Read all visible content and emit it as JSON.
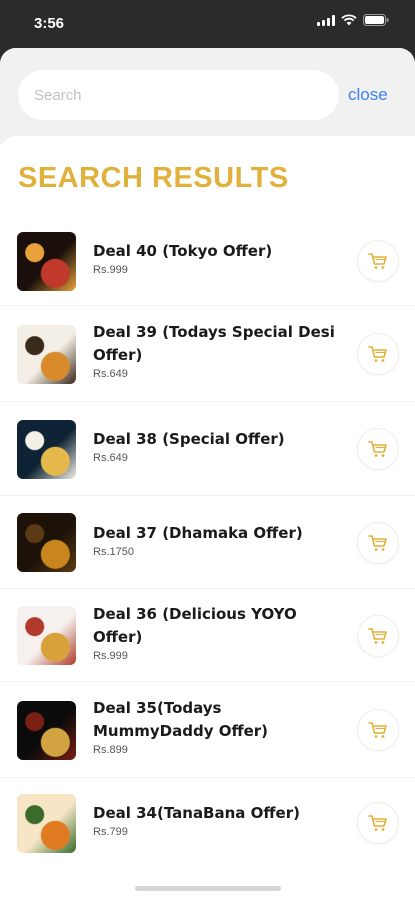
{
  "status_bar": {
    "time": "3:56"
  },
  "search": {
    "placeholder": "Search",
    "value": "",
    "close_label": "close"
  },
  "results": {
    "title": "SEARCH RESULTS",
    "items": [
      {
        "name": "Deal 40 (Tokyo Offer)",
        "price": "Rs.999",
        "thumb_colors": [
          "#1a0f0a",
          "#c0392b",
          "#e9a23b"
        ]
      },
      {
        "name": "Deal 39 (Todays Special Desi Offer)",
        "price": "Rs.649",
        "thumb_colors": [
          "#f3efe6",
          "#d98b2b",
          "#3a2a1a"
        ]
      },
      {
        "name": "Deal 38 (Special Offer)",
        "price": "Rs.649",
        "thumb_colors": [
          "#0e2436",
          "#e6b94c",
          "#f2efe5"
        ]
      },
      {
        "name": "Deal 37 (Dhamaka Offer)",
        "price": "Rs.1750",
        "thumb_colors": [
          "#1c1208",
          "#c9861f",
          "#5b3a14"
        ]
      },
      {
        "name": "Deal 36 (Delicious YOYO Offer)",
        "price": "Rs.999",
        "thumb_colors": [
          "#f4f1ee",
          "#d8a13c",
          "#b23a2a"
        ]
      },
      {
        "name": "Deal 35(Todays MummyDaddy Offer)",
        "price": "Rs.899",
        "thumb_colors": [
          "#0b0b0b",
          "#d2a341",
          "#7a1f14"
        ]
      },
      {
        "name": "Deal 34(TanaBana Offer)",
        "price": "Rs.799",
        "thumb_colors": [
          "#f6e6c6",
          "#e07b22",
          "#3a6b2a"
        ]
      }
    ]
  },
  "colors": {
    "accent": "#e0b23c",
    "link": "#3b82f6",
    "status_bg": "#2b2b2b"
  },
  "icons": {
    "cart": "shopping-cart-icon"
  }
}
